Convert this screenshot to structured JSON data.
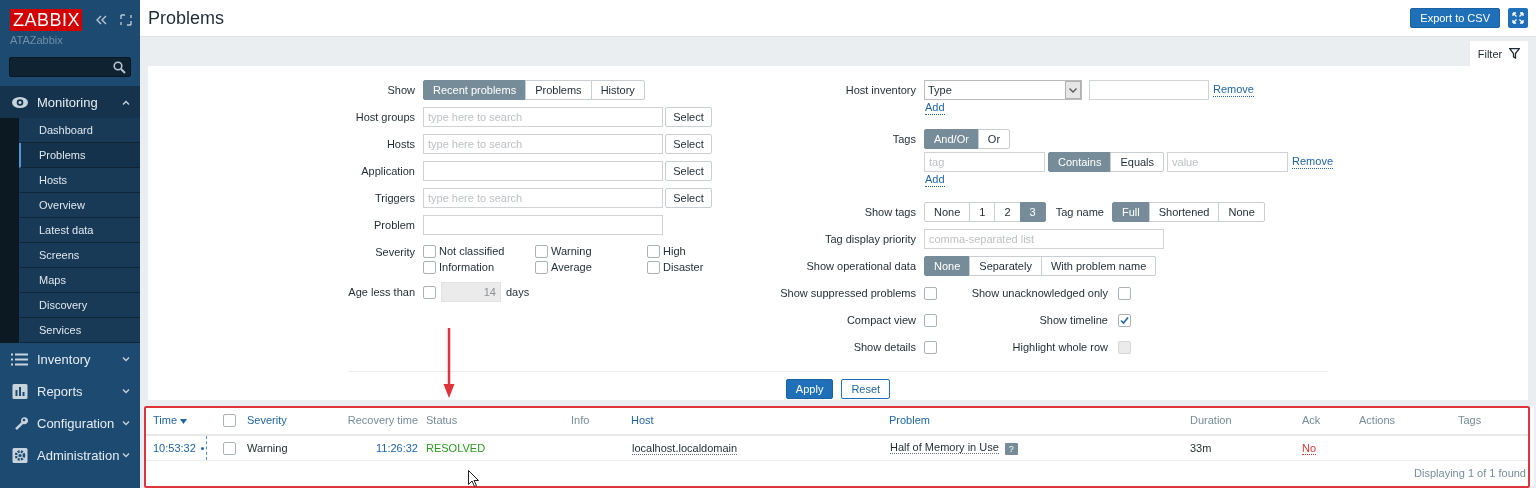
{
  "sidebar": {
    "logo": "ZABBIX",
    "server_name": "ATAZabbix",
    "menu": [
      {
        "label": "Monitoring",
        "expanded": true,
        "children": [
          {
            "label": "Dashboard",
            "selected": false
          },
          {
            "label": "Problems",
            "selected": true
          },
          {
            "label": "Hosts",
            "selected": false
          },
          {
            "label": "Overview",
            "selected": false
          },
          {
            "label": "Latest data",
            "selected": false
          },
          {
            "label": "Screens",
            "selected": false
          },
          {
            "label": "Maps",
            "selected": false
          },
          {
            "label": "Discovery",
            "selected": false
          },
          {
            "label": "Services",
            "selected": false
          }
        ]
      },
      {
        "label": "Inventory",
        "expanded": false
      },
      {
        "label": "Reports",
        "expanded": false
      },
      {
        "label": "Configuration",
        "expanded": false
      },
      {
        "label": "Administration",
        "expanded": false
      }
    ]
  },
  "header": {
    "title": "Problems",
    "export_button": "Export to CSV"
  },
  "filter": {
    "tab_label": "Filter",
    "left_rows": [
      {
        "kind": "segmented",
        "label": "Show",
        "options": [
          {
            "label": "Recent problems",
            "selected": true
          },
          {
            "label": "Problems",
            "selected": false
          },
          {
            "label": "History",
            "selected": false
          }
        ]
      },
      {
        "kind": "multiselect",
        "label": "Host groups",
        "placeholder": "type here to search",
        "button": "Select"
      },
      {
        "kind": "multiselect",
        "label": "Hosts",
        "placeholder": "type here to search",
        "button": "Select"
      },
      {
        "kind": "multiselect",
        "label": "Application",
        "button": "Select"
      },
      {
        "kind": "multiselect",
        "label": "Triggers",
        "placeholder": "type here to search",
        "button": "Select"
      },
      {
        "kind": "text",
        "label": "Problem"
      },
      {
        "kind": "checkgrid",
        "label": "Severity",
        "options": [
          {
            "label": "Not classified",
            "checked": false
          },
          {
            "label": "Warning",
            "checked": false
          },
          {
            "label": "High",
            "checked": false
          },
          {
            "label": "Information",
            "checked": false
          },
          {
            "label": "Average",
            "checked": false
          },
          {
            "label": "Disaster",
            "checked": false
          }
        ]
      },
      {
        "kind": "age",
        "label": "Age less than",
        "checked": false,
        "value": "14",
        "unit": "days"
      }
    ],
    "right_rows": [
      {
        "kind": "inventory",
        "label": "Host inventory",
        "select": "Type",
        "remove": "Remove",
        "add": "Add"
      },
      {
        "kind": "tags",
        "label": "Tags",
        "operators": [
          {
            "label": "And/Or",
            "selected": true
          },
          {
            "label": "Or",
            "selected": false
          }
        ],
        "tag_placeholder": "tag",
        "match": [
          {
            "label": "Contains",
            "selected": true
          },
          {
            "label": "Equals",
            "selected": false
          }
        ],
        "value_placeholder": "value",
        "remove": "Remove",
        "add": "Add"
      },
      {
        "kind": "showtags",
        "label": "Show tags",
        "options": [
          {
            "label": "None",
            "selected": false
          },
          {
            "label": "1",
            "selected": false
          },
          {
            "label": "2",
            "selected": false
          },
          {
            "label": "3",
            "selected": true
          }
        ],
        "tag_name_label": "Tag name",
        "tag_name_options": [
          {
            "label": "Full",
            "selected": true
          },
          {
            "label": "Shortened",
            "selected": false
          },
          {
            "label": "None",
            "selected": false
          }
        ]
      },
      {
        "kind": "text",
        "label": "Tag display priority",
        "placeholder": "comma-separated list"
      },
      {
        "kind": "segmented",
        "label": "Show operational data",
        "options": [
          {
            "label": "None",
            "selected": true
          },
          {
            "label": "Separately",
            "selected": false
          },
          {
            "label": "With problem name",
            "selected": false
          }
        ]
      },
      {
        "kind": "checkpair",
        "first": {
          "label": "Show suppressed problems",
          "checked": false,
          "disabled": false
        },
        "second": {
          "label": "Show unacknowledged only",
          "checked": false,
          "disabled": false
        }
      },
      {
        "kind": "checkpair",
        "first": {
          "label": "Compact view",
          "checked": false,
          "disabled": false
        },
        "second": {
          "label": "Show timeline",
          "checked": true,
          "disabled": false
        }
      },
      {
        "kind": "checkpair",
        "first": {
          "label": "Show details",
          "checked": false,
          "disabled": false
        },
        "second": {
          "label": "Highlight whole row",
          "checked": false,
          "disabled": true
        }
      }
    ],
    "buttons": [
      {
        "label": "Apply",
        "kind": "primary"
      },
      {
        "label": "Reset",
        "kind": "secondary"
      }
    ]
  },
  "problems_table": {
    "all_checked": false,
    "columns": [
      {
        "label": "Time",
        "sortable": true,
        "sorted": true
      },
      {
        "label": "Severity",
        "sortable": true,
        "sorted": false
      },
      {
        "label": "Recovery time",
        "sortable": false,
        "sorted": false
      },
      {
        "label": "Status",
        "sortable": false,
        "sorted": false
      },
      {
        "label": "Info",
        "sortable": false,
        "sorted": false
      },
      {
        "label": "Host",
        "sortable": true,
        "sorted": false
      },
      {
        "label": "Problem",
        "sortable": true,
        "sorted": false
      },
      {
        "label": "Duration",
        "sortable": false,
        "sorted": false
      },
      {
        "label": "Ack",
        "sortable": false,
        "sorted": false
      },
      {
        "label": "Actions",
        "sortable": false,
        "sorted": false
      },
      {
        "label": "Tags",
        "sortable": false,
        "sorted": false
      }
    ],
    "rows": [
      {
        "time": "10:53:32",
        "checked": false,
        "severity": "Warning",
        "recovery_time": "11:26:32",
        "status": "RESOLVED",
        "resolved": true,
        "host": "localhost.localdomain",
        "problem": "Half of Memory in Use",
        "comment_marker": "?",
        "duration": "33m",
        "ack": "No",
        "acknowledged": false
      }
    ],
    "footer": "Displaying 1 of 1 found"
  }
}
